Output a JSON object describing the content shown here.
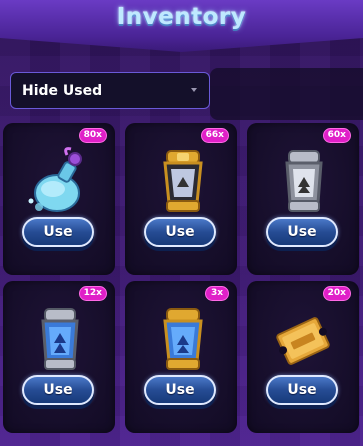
{
  "header": {
    "title": "Inventory"
  },
  "filter": {
    "selected": "Hide Used"
  },
  "colors": {
    "badge": "#e020c8",
    "button": "#264c94",
    "panel": "#4a2496"
  },
  "items": [
    {
      "name": "blue-potion",
      "count": "80x",
      "button": "Use",
      "icon": "potion-icon"
    },
    {
      "name": "gold-speed-lantern",
      "count": "66x",
      "button": "Use",
      "icon": "lantern-gold-icon"
    },
    {
      "name": "silver-lantern",
      "count": "60x",
      "button": "Use",
      "icon": "lantern-silver-icon"
    },
    {
      "name": "blue-silver-lantern",
      "count": "12x",
      "button": "Use",
      "icon": "lantern-blue-icon"
    },
    {
      "name": "blue-gold-lantern",
      "count": "3x",
      "button": "Use",
      "icon": "lantern-bluegold-icon"
    },
    {
      "name": "luck-ticket",
      "count": "20x",
      "button": "Use",
      "icon": "ticket-icon"
    }
  ]
}
